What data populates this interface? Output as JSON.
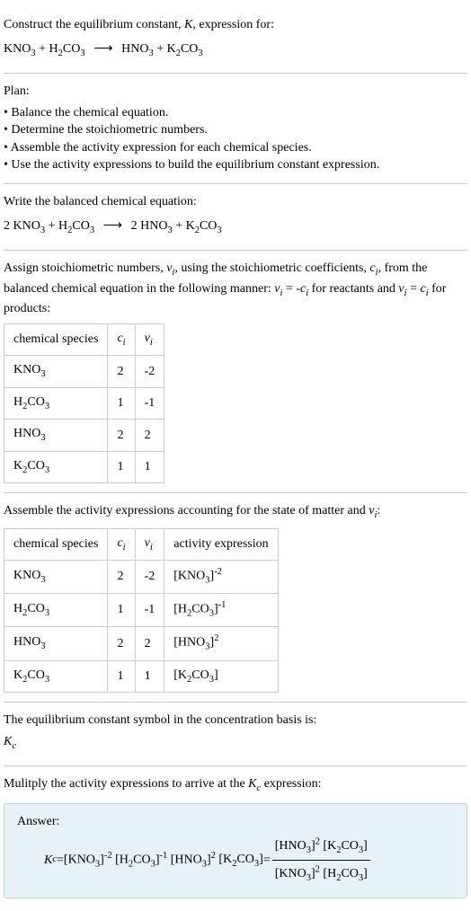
{
  "intro": {
    "line1_a": "Construct the equilibrium constant, ",
    "K": "K",
    "line1_b": ", expression for:",
    "eq_lhs1": "KNO",
    "eq_lhs1_sub": "3",
    "plus": " + ",
    "eq_lhs2": "H",
    "eq_lhs2_sub": "2",
    "eq_lhs3": "CO",
    "eq_lhs3_sub": "3",
    "arrow": "⟶",
    "eq_rhs1": "HNO",
    "eq_rhs1_sub": "3",
    "eq_rhs2": "K",
    "eq_rhs2_sub": "2",
    "eq_rhs3": "CO",
    "eq_rhs3_sub": "3"
  },
  "plan": {
    "title": "Plan:",
    "b1": "• Balance the chemical equation.",
    "b2": "• Determine the stoichiometric numbers.",
    "b3": "• Assemble the activity expression for each chemical species.",
    "b4": "• Use the activity expressions to build the equilibrium constant expression."
  },
  "balanced": {
    "title": "Write the balanced chemical equation:",
    "c1": "2 KNO",
    "c1s": "3",
    "c2": "H",
    "c2s": "2",
    "c3": "CO",
    "c3s": "3",
    "arrow": "⟶",
    "c4": "2 HNO",
    "c4s": "3",
    "c5": "K",
    "c5s": "2",
    "c6": "CO",
    "c6s": "3"
  },
  "assign": {
    "p1": "Assign stoichiometric numbers, ",
    "nu": "ν",
    "isub": "i",
    "p2": ", using the stoichiometric coefficients, ",
    "c": "c",
    "p3": ", from the balanced chemical equation in the following manner: ",
    "eq1a": "ν",
    "eq1b": " = -",
    "eq1c": "c",
    "p4": " for reactants and ",
    "eq2a": "ν",
    "eq2b": " = ",
    "eq2c": "c",
    "p5": " for products:"
  },
  "table1": {
    "h1": "chemical species",
    "h2": "c",
    "h2sub": "i",
    "h3": "ν",
    "h3sub": "i",
    "rows": [
      {
        "sp1": "KNO",
        "sp1s": "3",
        "sp2": "",
        "sp2s": "",
        "c": "2",
        "v": "-2"
      },
      {
        "sp1": "H",
        "sp1s": "2",
        "sp2": "CO",
        "sp2s": "3",
        "c": "1",
        "v": "-1"
      },
      {
        "sp1": "HNO",
        "sp1s": "3",
        "sp2": "",
        "sp2s": "",
        "c": "2",
        "v": "2"
      },
      {
        "sp1": "K",
        "sp1s": "2",
        "sp2": "CO",
        "sp2s": "3",
        "c": "1",
        "v": "1"
      }
    ]
  },
  "assemble": {
    "p1": "Assemble the activity expressions accounting for the state of matter and ",
    "nu": "ν",
    "isub": "i",
    "p2": ":"
  },
  "table2": {
    "h1": "chemical species",
    "h2": "c",
    "h2sub": "i",
    "h3": "ν",
    "h3sub": "i",
    "h4": "activity expression",
    "rows": [
      {
        "sp1": "KNO",
        "sp1s": "3",
        "sp2": "",
        "sp2s": "",
        "c": "2",
        "v": "-2",
        "a1": "[KNO",
        "a1s": "3",
        "a2": "]",
        "exp": "-2"
      },
      {
        "sp1": "H",
        "sp1s": "2",
        "sp2": "CO",
        "sp2s": "3",
        "c": "1",
        "v": "-1",
        "a1": "[H",
        "a1s": "2",
        "a2": "CO",
        "a2s": "3",
        "a3": "]",
        "exp": "-1"
      },
      {
        "sp1": "HNO",
        "sp1s": "3",
        "sp2": "",
        "sp2s": "",
        "c": "2",
        "v": "2",
        "a1": "[HNO",
        "a1s": "3",
        "a2": "]",
        "exp": "2"
      },
      {
        "sp1": "K",
        "sp1s": "2",
        "sp2": "CO",
        "sp2s": "3",
        "c": "1",
        "v": "1",
        "a1": "[K",
        "a1s": "2",
        "a2": "CO",
        "a2s": "3",
        "a3": "]",
        "exp": ""
      }
    ]
  },
  "symbol": {
    "p1": "The equilibrium constant symbol in the concentration basis is:",
    "kc": "K",
    "kcsub": "c"
  },
  "multiply": {
    "p1a": "Mulitply the activity expressions to arrive at the ",
    "kc": "K",
    "kcsub": "c",
    "p1b": " expression:"
  },
  "answer": {
    "label": "Answer:",
    "kc": "K",
    "kcsub": "c",
    "eq": " = ",
    "t1": "[KNO",
    "t1s": "3",
    "t1e": "-2",
    "t2": "[H",
    "t2s": "2",
    "t2b": "CO",
    "t2bs": "3",
    "t2e": "-1",
    "t3": "[HNO",
    "t3s": "3",
    "t3e": "2",
    "t4": "[K",
    "t4s": "2",
    "t4b": "CO",
    "t4bs": "3",
    "num1": "[HNO",
    "num1s": "3",
    "num1e": "2",
    "num2": "[K",
    "num2s": "2",
    "num2b": "CO",
    "num2bs": "3",
    "den1": "[KNO",
    "den1s": "3",
    "den1e": "2",
    "den2": "[H",
    "den2s": "2",
    "den2b": "CO",
    "den2bs": "3",
    "close": "]"
  }
}
